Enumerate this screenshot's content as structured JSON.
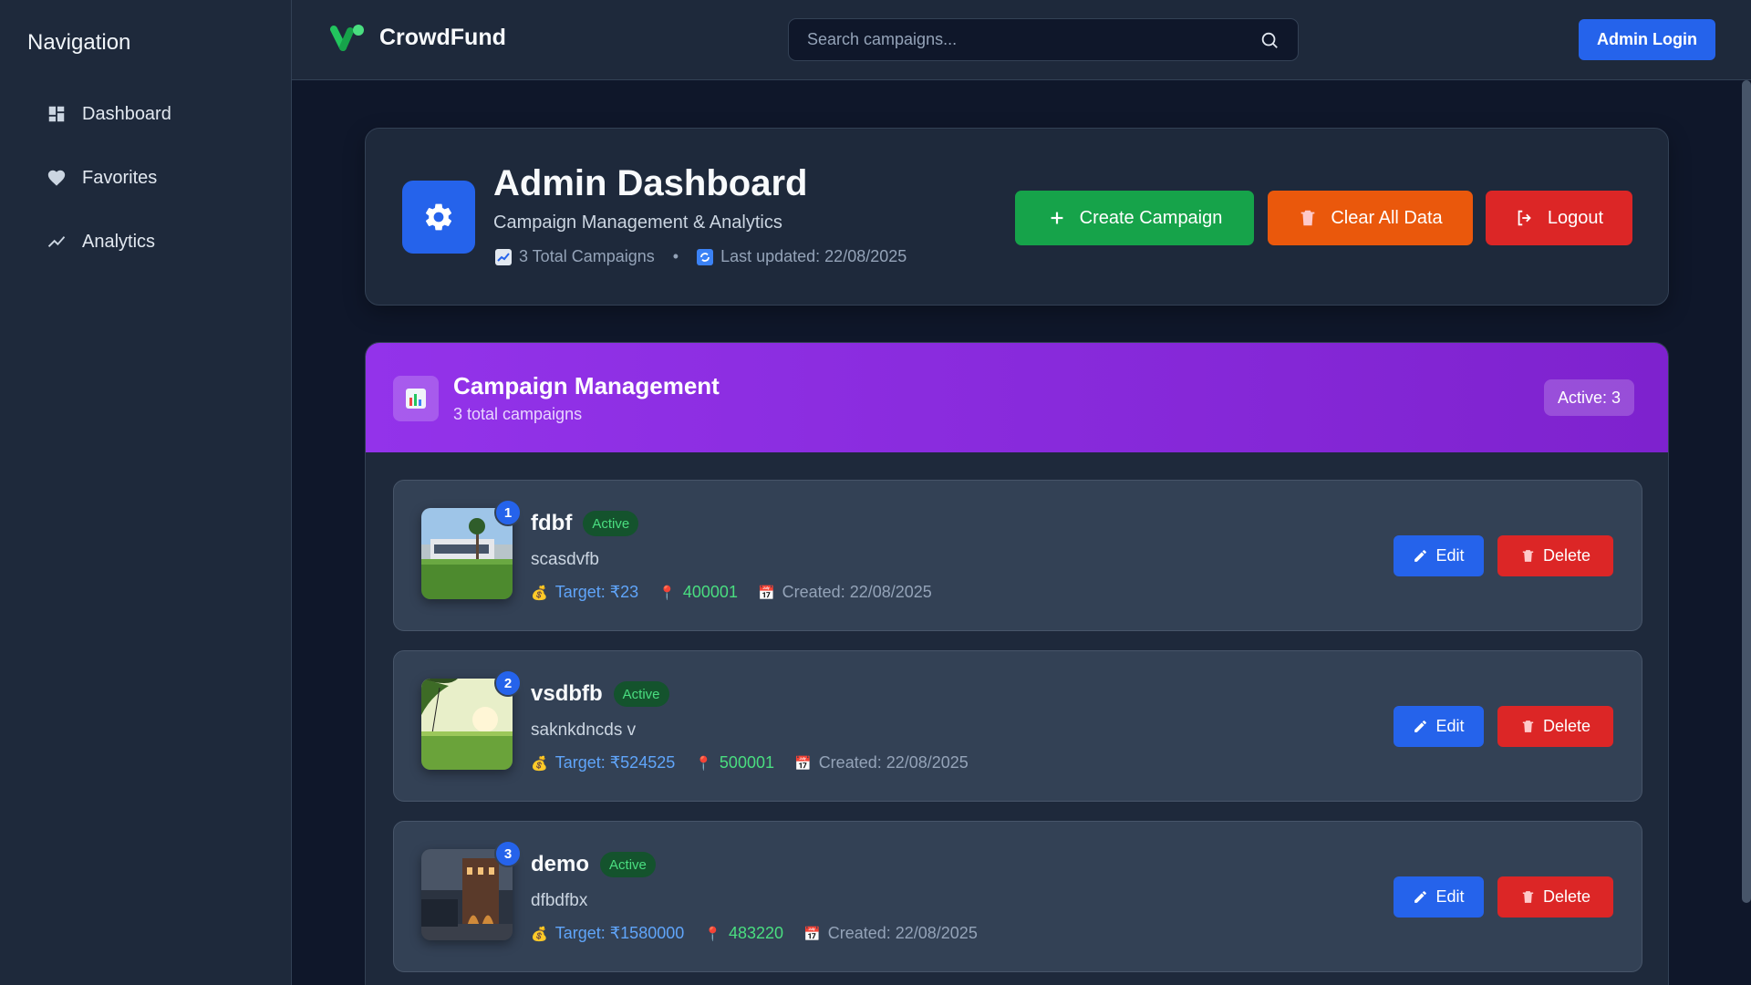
{
  "sidebar": {
    "title": "Navigation",
    "items": [
      {
        "label": "Dashboard",
        "icon": "dashboard-icon"
      },
      {
        "label": "Favorites",
        "icon": "heart-icon"
      },
      {
        "label": "Analytics",
        "icon": "trending-icon"
      }
    ]
  },
  "topbar": {
    "brand": "CrowdFund",
    "search_placeholder": "Search campaigns...",
    "admin_login": "Admin Login"
  },
  "header": {
    "title": "Admin Dashboard",
    "subtitle": "Campaign Management & Analytics",
    "total_campaigns": "3 Total Campaigns",
    "last_updated": "Last updated: 22/08/2025",
    "create_label": "Create Campaign",
    "clear_label": "Clear All Data",
    "logout_label": "Logout"
  },
  "management": {
    "title": "Campaign Management",
    "subtitle": "3 total campaigns",
    "active_pill": "Active: 3"
  },
  "campaigns": [
    {
      "num": "1",
      "name": "fdbf",
      "status": "Active",
      "desc": "scasdvfb",
      "target": "Target: ₹23",
      "pincode": "400001",
      "created": "Created: 22/08/2025"
    },
    {
      "num": "2",
      "name": "vsdbfb",
      "status": "Active",
      "desc": "saknkdncds v",
      "target": "Target: ₹524525",
      "pincode": "500001",
      "created": "Created: 22/08/2025"
    },
    {
      "num": "3",
      "name": "demo",
      "status": "Active",
      "desc": "dfbdfbx",
      "target": "Target: ₹1580000",
      "pincode": "483220",
      "created": "Created: 22/08/2025"
    }
  ],
  "actions": {
    "edit": "Edit",
    "delete": "Delete"
  },
  "colors": {
    "primary": "#2563eb",
    "success": "#16a34a",
    "warning": "#ea580c",
    "danger": "#dc2626",
    "purple": "#9333ea"
  }
}
